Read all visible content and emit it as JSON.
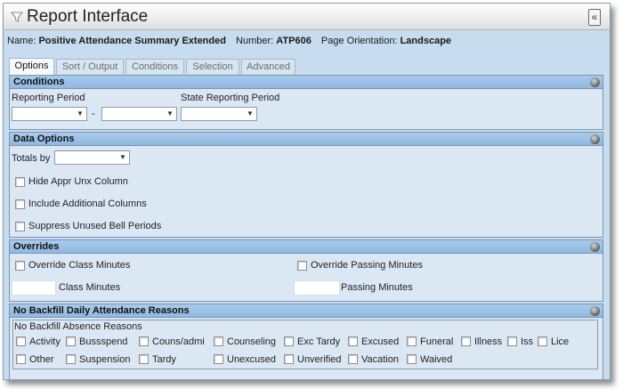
{
  "window": {
    "title": "Report Interface",
    "collapse_glyph": "«",
    "icons": [
      "filter-icon",
      "collapse-icon"
    ]
  },
  "info": {
    "name_label": "Name:",
    "name_value": "Positive Attendance Summary Extended",
    "number_label": "Number:",
    "number_value": "ATP606",
    "orientation_label": "Page Orientation:",
    "orientation_value": "Landscape"
  },
  "tabs": [
    "Options",
    "Sort / Output",
    "Conditions",
    "Selection",
    "Advanced"
  ],
  "active_tab": "Options",
  "conditions": {
    "title": "Conditions",
    "reporting_period_label": "Reporting Period",
    "range_separator": "-",
    "state_reporting_period_label": "State Reporting Period",
    "reporting_period_from": "",
    "reporting_period_to": "",
    "state_reporting_period": ""
  },
  "data_options": {
    "title": "Data Options",
    "totals_by_label": "Totals by",
    "totals_by_value": "",
    "hide_appr_unx": "Hide Appr Unx Column",
    "include_additional": "Include Additional Columns",
    "suppress_unused": "Suppress Unused Bell Periods"
  },
  "overrides": {
    "title": "Overrides",
    "override_class": "Override Class Minutes",
    "override_passing": "Override Passing Minutes",
    "class_minutes_label": "Class Minutes",
    "class_minutes_value": "",
    "passing_minutes_label": "Passing Minutes",
    "passing_minutes_value": ""
  },
  "backfill": {
    "title": "No Backfill Daily Attendance Reasons",
    "group_label": "No Backfill Absence Reasons",
    "row1": [
      "Activity",
      "Bussspend",
      "Couns/admi",
      "Counseling",
      "Exc Tardy",
      "Excused",
      "Funeral",
      "Illness",
      "Iss",
      "Lice"
    ],
    "row2": [
      "Other",
      "Suspension",
      "Tardy",
      "Unexcused",
      "Unverified",
      "Vacation",
      "Waived"
    ]
  },
  "colors": {
    "window_bg": "#c7dcee",
    "panel_header": "#9dc2e8",
    "panel_body": "#dbe8f4"
  }
}
